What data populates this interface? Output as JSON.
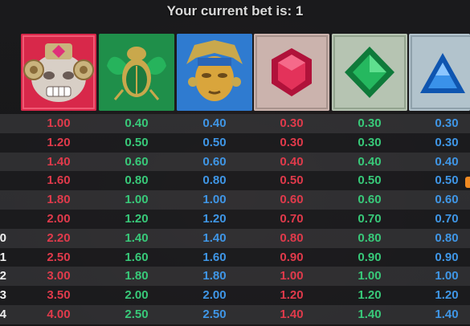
{
  "header": {
    "title": "Your current bet is: 1"
  },
  "symbols": [
    {
      "name": "guardian-mask-icon",
      "bg": "#d8284a"
    },
    {
      "name": "scarab-icon",
      "bg": "#1f8f4a"
    },
    {
      "name": "golden-mask-icon",
      "bg": "#2f7bd0"
    },
    {
      "name": "red-gem-icon",
      "bg": "#cbb3ad"
    },
    {
      "name": "green-gem-icon",
      "bg": "#b6c4b2"
    },
    {
      "name": "blue-gem-icon",
      "bg": "#b2c3cc"
    }
  ],
  "colors": {
    "red": "#e03a4b",
    "green": "#38c979",
    "blue": "#3f96e6",
    "accent": "#f08a22"
  },
  "rows": [
    {
      "label": "",
      "values": [
        "1.00",
        "0.40",
        "0.40",
        "0.30",
        "0.30",
        "0.30"
      ]
    },
    {
      "label": "",
      "values": [
        "1.20",
        "0.50",
        "0.50",
        "0.30",
        "0.30",
        "0.30"
      ]
    },
    {
      "label": "",
      "values": [
        "1.40",
        "0.60",
        "0.60",
        "0.40",
        "0.40",
        "0.40"
      ]
    },
    {
      "label": "",
      "values": [
        "1.60",
        "0.80",
        "0.80",
        "0.50",
        "0.50",
        "0.50"
      ]
    },
    {
      "label": "",
      "values": [
        "1.80",
        "1.00",
        "1.00",
        "0.60",
        "0.60",
        "0.60"
      ]
    },
    {
      "label": "",
      "values": [
        "2.00",
        "1.20",
        "1.20",
        "0.70",
        "0.70",
        "0.70"
      ]
    },
    {
      "label": "0",
      "values": [
        "2.20",
        "1.40",
        "1.40",
        "0.80",
        "0.80",
        "0.80"
      ]
    },
    {
      "label": "1",
      "values": [
        "2.50",
        "1.60",
        "1.60",
        "0.90",
        "0.90",
        "0.90"
      ]
    },
    {
      "label": "2",
      "values": [
        "3.00",
        "1.80",
        "1.80",
        "1.00",
        "1.00",
        "1.00"
      ]
    },
    {
      "label": "3",
      "values": [
        "3.50",
        "2.00",
        "2.00",
        "1.20",
        "1.20",
        "1.20"
      ]
    },
    {
      "label": "4",
      "values": [
        "4.00",
        "2.50",
        "2.50",
        "1.40",
        "1.40",
        "1.40"
      ]
    }
  ]
}
